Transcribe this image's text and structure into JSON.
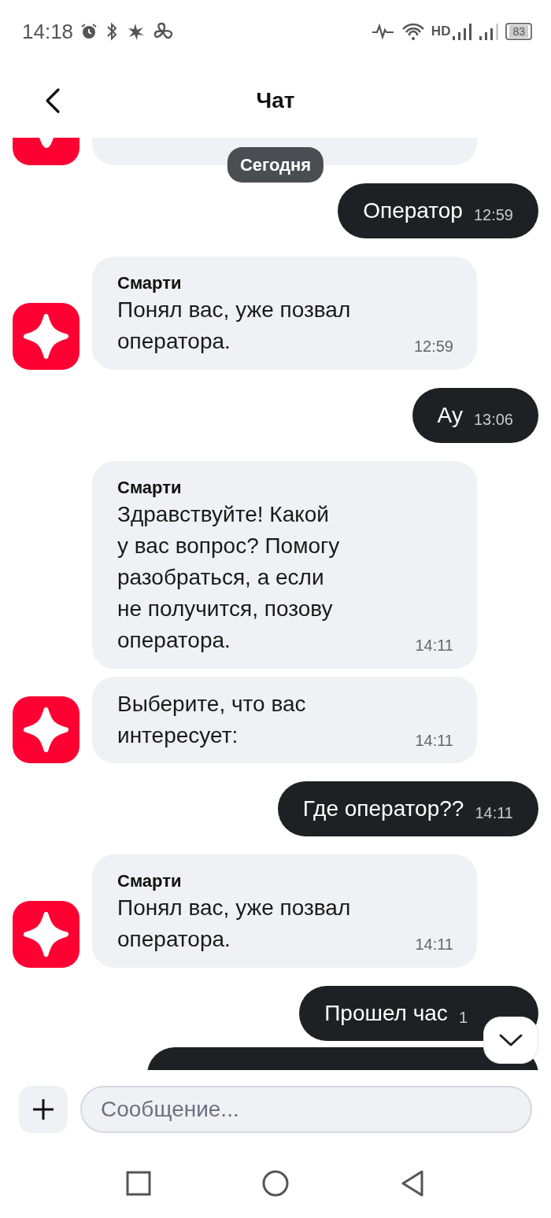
{
  "status_bar": {
    "time": "14:18",
    "network": "HD",
    "battery": "83"
  },
  "header": {
    "title": "Чат"
  },
  "date_chip": "Сегодня",
  "messages": [
    {
      "kind": "incoming",
      "partial": true,
      "avatar": true
    },
    {
      "kind": "outgoing",
      "text": "Оператор",
      "time": "12:59"
    },
    {
      "kind": "incoming",
      "sender": "Смарти",
      "text": "Понял вас, уже позвал\nоператора.",
      "time": "12:59",
      "avatar": true
    },
    {
      "kind": "outgoing",
      "text": "Ау",
      "time": "13:06"
    },
    {
      "kind": "incoming",
      "sender": "Смарти",
      "text": "Здравствуйте! Какой\nу вас вопрос? Помогу\nразобраться, а если\nне получится, позову\nоператора.",
      "time": "14:11",
      "avatar": false
    },
    {
      "kind": "incoming",
      "text": "Выберите, что вас\nинтересует:",
      "time": "14:11",
      "avatar": true
    },
    {
      "kind": "outgoing",
      "text": "Где оператор??",
      "time": "14:11"
    },
    {
      "kind": "incoming",
      "sender": "Смарти",
      "text": "Понял вас, уже позвал\nоператора.",
      "time": "14:11",
      "avatar": true
    },
    {
      "kind": "outgoing",
      "text": "Прошел час",
      "time": "1"
    },
    {
      "kind": "outgoing",
      "partial": true
    }
  ],
  "composer": {
    "placeholder": "Сообщение..."
  }
}
